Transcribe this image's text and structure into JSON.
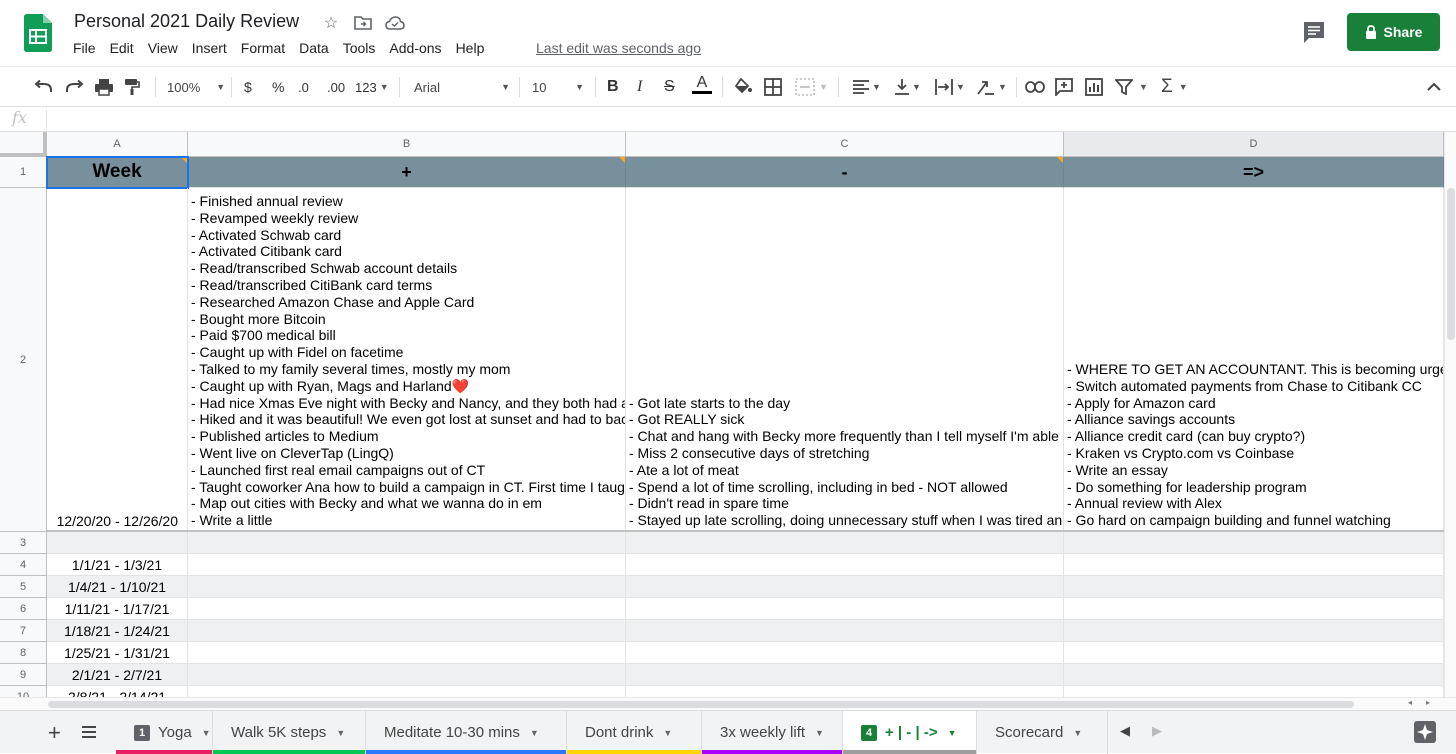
{
  "app": {
    "title": "Personal 2021 Daily Review",
    "last_edit": "Last edit was seconds ago",
    "share_label": "Share"
  },
  "menu": [
    "File",
    "Edit",
    "View",
    "Insert",
    "Format",
    "Data",
    "Tools",
    "Add-ons",
    "Help"
  ],
  "toolbar": {
    "zoom": "100%",
    "currency": "$",
    "percent": "%",
    "dec_less": ".0",
    "dec_more": ".00",
    "more_formats": "123",
    "font": "Arial",
    "font_size": "10",
    "bold": "B",
    "italic": "I",
    "strike": "S",
    "text_color": "A"
  },
  "formula": {
    "fx": "fx"
  },
  "columns": [
    "A",
    "B",
    "C",
    "D"
  ],
  "rows": [
    "1",
    "2",
    "3",
    "4",
    "5",
    "6",
    "7",
    "8",
    "9",
    "10"
  ],
  "header_row": [
    "Week",
    "+",
    "-",
    "=>"
  ],
  "row2": {
    "week": "12/20/20 - 12/26/20",
    "plus": [
      "- Finished annual review",
      "- Revamped weekly review",
      "- Activated Schwab card",
      "- Activated Citibank card",
      "- Read/transcribed Schwab account details",
      "- Read/transcribed CitiBank card terms",
      "- Researched Amazon Chase and Apple Card",
      "- Bought more Bitcoin",
      "- Paid $700 medical bill",
      "- Caught up with Fidel on facetime",
      "- Talked to my family several times, mostly my mom",
      "- Caught up with Ryan, Mags and Harland❤️",
      "- Had nice Xmas Eve night with Becky and Nancy, and they both had a",
      "- Hiked and it was beautiful! We even got lost at sunset and had to bac",
      "- Published articles to Medium",
      "- Went live on CleverTap (LingQ)",
      "- Launched first real email campaigns out of CT",
      "- Taught coworker Ana how to build a campaign in CT. First time I taug",
      "- Map out cities with Becky and what we wanna do in em",
      "- Write a little"
    ],
    "minus": [
      "- Got late starts to the day",
      "- Got REALLY sick",
      "- Chat and hang with Becky more frequently than I tell myself I'm able t",
      "- Miss 2 consecutive days of stretching",
      "- Ate a lot of meat",
      "- Spend a lot of time scrolling, including in bed - NOT allowed",
      "- Didn't read in spare time",
      "- Stayed up late scrolling, doing unnecessary stuff when I was tired and"
    ],
    "next": [
      "- WHERE TO GET AN ACCOUNTANT. This is becoming urge",
      "- Switch automated payments from Chase to Citibank CC",
      "- Apply for Amazon card",
      "- Alliance savings accounts",
      "- Alliance credit card (can buy crypto?)",
      "- Kraken vs Crypto.com vs Coinbase",
      "- Write an essay",
      "- Do something for leadership program",
      "- Annual review with Alex",
      "- Go hard on campaign building and funnel watching"
    ]
  },
  "weeks": [
    "1/1/21 - 1/3/21",
    "1/4/21 - 1/10/21",
    "1/11/21 - 1/17/21",
    "1/18/21 - 1/24/21",
    "1/25/21 - 1/31/21",
    "2/1/21 - 2/7/21",
    "2/8/21 - 2/14/21"
  ],
  "sheets": [
    {
      "label": "Yoga",
      "badge": "1",
      "color": "#e91e63"
    },
    {
      "label": "Walk 5K steps",
      "badge": "",
      "color": "#00c853"
    },
    {
      "label": "Meditate 10-30 mins",
      "badge": "",
      "color": "#2979ff"
    },
    {
      "label": "Dont drink",
      "badge": "",
      "color": "#ffd600"
    },
    {
      "label": "3x weekly lift",
      "badge": "",
      "color": "#aa00ff"
    },
    {
      "label": "+ | - | ->",
      "badge": "4",
      "color": "#9e9e9e"
    },
    {
      "label": "Scorecard",
      "badge": "",
      "color": ""
    }
  ],
  "colors": {
    "header_fill": "#78909c",
    "accent_green": "#188038",
    "selection_blue": "#1a73e8"
  }
}
